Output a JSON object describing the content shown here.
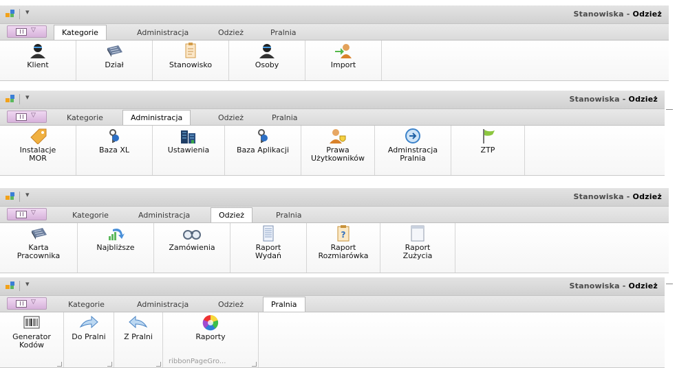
{
  "window": {
    "title_prefix": "Stanowiska - ",
    "title_app": "Odzież"
  },
  "tabs": [
    "Kategorie",
    "Administracja",
    "Odzież",
    "Pralnia"
  ],
  "ribbons": [
    {
      "active_tab": 0,
      "buttons": [
        {
          "label": "Klient",
          "icon": "user-icon"
        },
        {
          "label": "Dział",
          "icon": "grid-icon"
        },
        {
          "label": "Stanowisko",
          "icon": "clipboard-icon"
        },
        {
          "label": "Osoby",
          "icon": "user-icon"
        },
        {
          "label": "Import",
          "icon": "import-icon"
        }
      ]
    },
    {
      "active_tab": 1,
      "buttons": [
        {
          "label": "Instalacje MOR",
          "icon": "tag-icon"
        },
        {
          "label": "Baza XL",
          "icon": "key-icon"
        },
        {
          "label": "Ustawienia",
          "icon": "building-icon"
        },
        {
          "label": "Baza Aplikacji",
          "icon": "key-icon"
        },
        {
          "label": "Prawa Użytkowników",
          "icon": "user-shield-icon"
        },
        {
          "label": "Adminstracja Pralnia",
          "icon": "circle-arrow-icon"
        },
        {
          "label": "ZTP",
          "icon": "flag-icon"
        }
      ]
    },
    {
      "active_tab": 2,
      "buttons": [
        {
          "label": "Karta Pracownika",
          "icon": "grid-icon"
        },
        {
          "label": "Najbliższe",
          "icon": "chart-arrow-icon"
        },
        {
          "label": "Zamówienia",
          "icon": "binoculars-icon"
        },
        {
          "label": "Raport Wydań",
          "icon": "document-icon"
        },
        {
          "label": "Raport Rozmiarówka",
          "icon": "question-doc-icon"
        },
        {
          "label": "Raport Zużycia",
          "icon": "blank-doc-icon"
        }
      ]
    },
    {
      "active_tab": 3,
      "buttons": [
        {
          "label": "Generator Kodów",
          "icon": "barcode-icon"
        },
        {
          "label": "Do Pralni",
          "icon": "arrow-right-icon"
        },
        {
          "label": "Z Pralni",
          "icon": "arrow-left-icon"
        },
        {
          "label": "Raporty",
          "icon": "color-wheel-icon"
        }
      ],
      "group_label": "ribbonPageGro..."
    }
  ]
}
